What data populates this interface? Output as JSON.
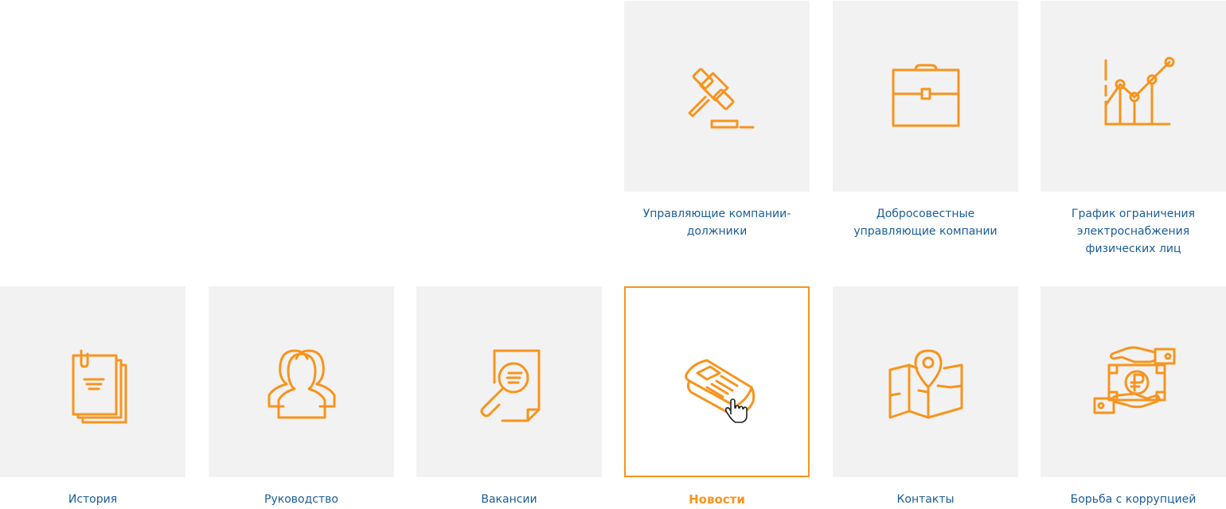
{
  "accent_color": "#f7941d",
  "label_color": "#1a5d99",
  "tiles": [
    {
      "label": "Управляющие компании-должники",
      "icon": "gavel-icon"
    },
    {
      "label": "Добросовестные управляющие компании",
      "icon": "briefcase-icon"
    },
    {
      "label": "График ограничения электроснабжения физических лиц",
      "icon": "line-chart-icon"
    },
    {
      "label": "История",
      "icon": "documents-icon"
    },
    {
      "label": "Руководство",
      "icon": "people-icon"
    },
    {
      "label": "Вакансии",
      "icon": "document-search-icon"
    },
    {
      "label": "Новости",
      "icon": "newspaper-icon",
      "active": true
    },
    {
      "label": "Контакты",
      "icon": "map-pin-icon"
    },
    {
      "label": "Борьба с коррупцией",
      "icon": "bribe-money-icon"
    }
  ]
}
